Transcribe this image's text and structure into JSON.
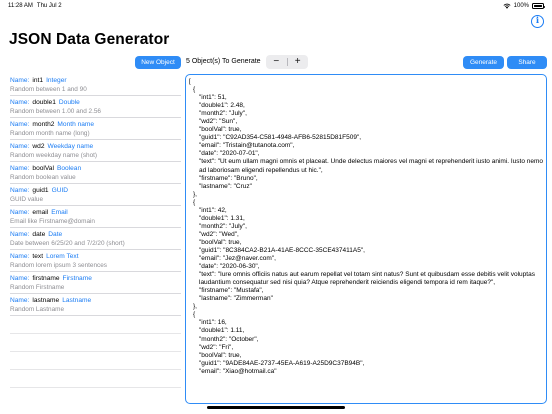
{
  "status_bar": {
    "time": "11:28 AM",
    "date": "Thu Jul 2",
    "battery": "100%"
  },
  "header": {
    "title": "JSON Data Generator"
  },
  "toolbar": {
    "new_object_label": "New Object",
    "count_label": "5 Object(s) To Generate",
    "minus_label": "−",
    "plus_label": "+",
    "generate_label": "Generate",
    "share_label": "Share"
  },
  "fields": [
    {
      "name_prefix": "Name:",
      "name": "int1",
      "type": "Integer",
      "description": "Random between 1 and 90"
    },
    {
      "name_prefix": "Name:",
      "name": "double1",
      "type": "Double",
      "description": "Random between 1.00 and 2.56"
    },
    {
      "name_prefix": "Name:",
      "name": "month2",
      "type": "Month name",
      "description": "Random month name (long)"
    },
    {
      "name_prefix": "Name:",
      "name": "wd2",
      "type": "Weekday name",
      "description": "Random weekday name (shot)"
    },
    {
      "name_prefix": "Name:",
      "name": "boolVal",
      "type": "Boolean",
      "description": "Random boolean value"
    },
    {
      "name_prefix": "Name:",
      "name": "guid1",
      "type": "GUID",
      "description": "GUID value"
    },
    {
      "name_prefix": "Name:",
      "name": "email",
      "type": "Email",
      "description": "Email like  Firstname@domain"
    },
    {
      "name_prefix": "Name:",
      "name": "date",
      "type": "Date",
      "description": "Date between 6/25/20 and 7/2/20 (short)"
    },
    {
      "name_prefix": "Name:",
      "name": "text",
      "type": "Lorem Text",
      "description": "Random lorem ipsum 3 sentences"
    },
    {
      "name_prefix": "Name:",
      "name": "firstname",
      "type": "Firstname",
      "description": "Random Firstname"
    },
    {
      "name_prefix": "Name:",
      "name": "lastname",
      "type": "Lastname",
      "description": "Random Lastname"
    }
  ],
  "json_output": [
    {
      "indent": 0,
      "text": "["
    },
    {
      "indent": 1,
      "text": "{"
    },
    {
      "indent": 2,
      "text": "\"int1\": 51,"
    },
    {
      "indent": 2,
      "text": "\"double1\": 2.48,"
    },
    {
      "indent": 2,
      "text": "\"month2\": \"July\","
    },
    {
      "indent": 2,
      "text": "\"wd2\": \"Sun\","
    },
    {
      "indent": 2,
      "text": "\"boolVal\": true,"
    },
    {
      "indent": 2,
      "text": "\"guid1\": \"C92AD354-C581-4948-AFB6-52815D81F509\","
    },
    {
      "indent": 2,
      "text": "\"email\": \"Tristain@tutanota.com\","
    },
    {
      "indent": 2,
      "text": "\"date\": \"2020-07-01\","
    },
    {
      "indent": 2,
      "text": "\"text\": \"Ut eum ullam magni omnis et placeat. Unde delectus maiores vel magni et reprehenderit iusto animi. Iusto nemo ad laboriosam eligendi repellendus ut hic.\","
    },
    {
      "indent": 2,
      "text": "\"firstname\": \"Bruno\","
    },
    {
      "indent": 2,
      "text": "\"lastname\": \"Cruz\""
    },
    {
      "indent": 1,
      "text": "},"
    },
    {
      "indent": 1,
      "text": "{"
    },
    {
      "indent": 2,
      "text": "\"int1\": 42,"
    },
    {
      "indent": 2,
      "text": "\"double1\": 1.31,"
    },
    {
      "indent": 2,
      "text": "\"month2\": \"July\","
    },
    {
      "indent": 2,
      "text": "\"wd2\": \"Wed\","
    },
    {
      "indent": 2,
      "text": "\"boolVal\": true,"
    },
    {
      "indent": 2,
      "text": "\"guid1\": \"8C384CA2-B21A-41AE-8CCC-35CE437411A5\","
    },
    {
      "indent": 2,
      "text": "\"email\": \"Jez@naver.com\","
    },
    {
      "indent": 2,
      "text": "\"date\": \"2020-06-30\","
    },
    {
      "indent": 2,
      "text": "\"text\": \"Iure omnis officiis natus aut earum repellat vel totam sint natus? Sunt et quibusdam esse debitis velit voluptas laudantium consequatur sed nisi quia? Atque reprehenderit reiciendis eligendi tempora id rem itaque?\","
    },
    {
      "indent": 2,
      "text": "\"firstname\": \"Mustafa\","
    },
    {
      "indent": 2,
      "text": "\"lastname\": \"Zimmerman\""
    },
    {
      "indent": 1,
      "text": "},"
    },
    {
      "indent": 1,
      "text": "{"
    },
    {
      "indent": 2,
      "text": "\"int1\": 16,"
    },
    {
      "indent": 2,
      "text": "\"double1\": 1.11,"
    },
    {
      "indent": 2,
      "text": "\"month2\": \"October\","
    },
    {
      "indent": 2,
      "text": "\"wd2\": \"Fri\","
    },
    {
      "indent": 2,
      "text": "\"boolVal\": true,"
    },
    {
      "indent": 2,
      "text": "\"guid1\": \"9ADE84AE-2737-45EA-A619-A25D9C37B94B\","
    },
    {
      "indent": 2,
      "text": "\"email\": \"Xiao@hotmail.ca\""
    }
  ],
  "colors": {
    "accent": "#2f8cf6",
    "link": "#1a7cf4",
    "secondary_text": "#8e8e93"
  },
  "icons": {
    "info": "info-circle-icon",
    "wifi": "wifi-icon",
    "battery": "battery-icon"
  }
}
